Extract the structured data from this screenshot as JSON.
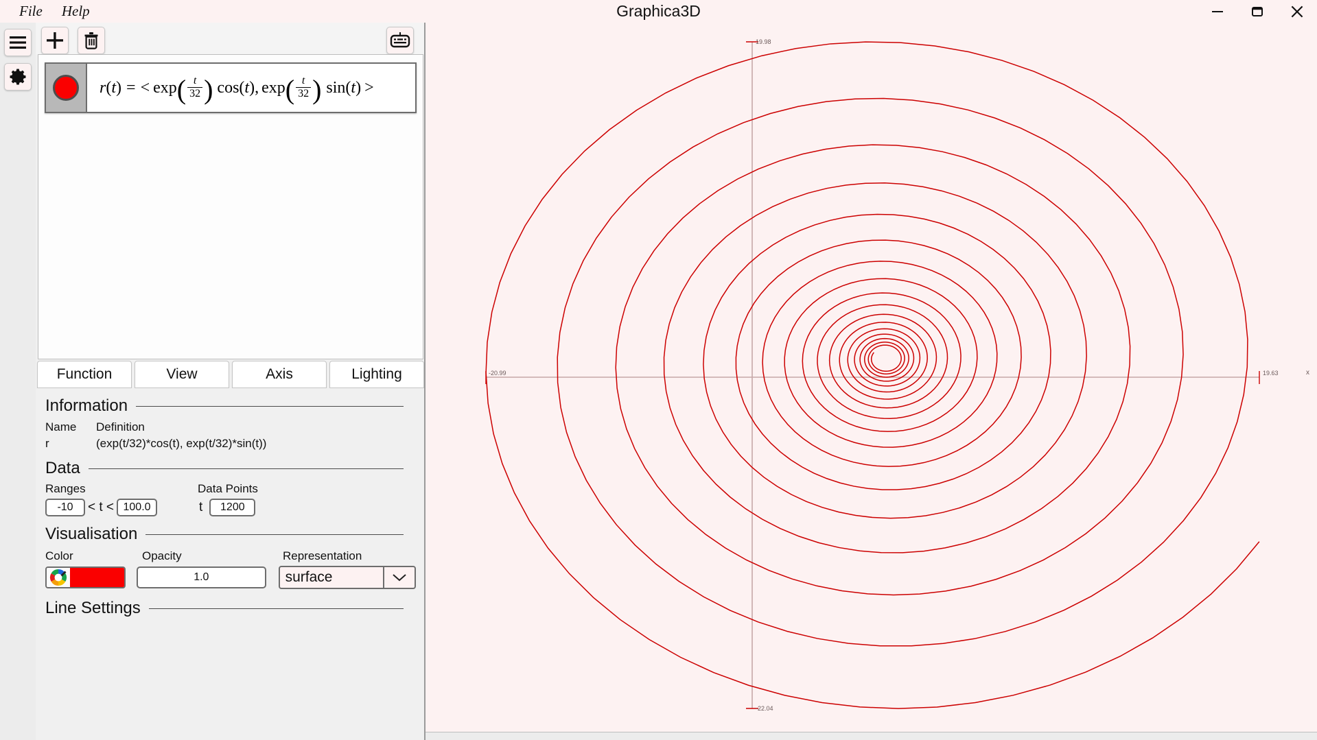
{
  "window": {
    "title": "Graphica3D",
    "menu": [
      {
        "label": "File",
        "name": "menu-file"
      },
      {
        "label": "Help",
        "name": "menu-help"
      }
    ],
    "controls": {
      "minimize": "minimize-icon",
      "restore": "restore-icon",
      "close": "close-icon"
    }
  },
  "rail": {
    "items": [
      {
        "label": "Menu",
        "icon": "hamburger-menu-icon"
      },
      {
        "label": "Settings",
        "icon": "gear-icon"
      }
    ]
  },
  "toolbar": {
    "add_label": "+",
    "add_icon": "plus-icon",
    "delete_icon": "trash-icon",
    "keyboard_icon": "keyboard-icon"
  },
  "functions": [
    {
      "name": "r",
      "color": "#fa0000",
      "equation_text": "r(t) = < exp(t/32) cos(t), exp(t/32) sin(t) >",
      "lhs": "r",
      "var": "t",
      "eq": "=",
      "open_angle": "<",
      "close_angle": ">",
      "exp": "exp",
      "cos": "cos",
      "sin": "sin",
      "num": "t",
      "den": "32",
      "comma": ","
    }
  ],
  "tabs": [
    {
      "label": "Function",
      "active": true
    },
    {
      "label": "View",
      "active": false
    },
    {
      "label": "Axis",
      "active": false
    },
    {
      "label": "Lighting",
      "active": false
    }
  ],
  "function_tab": {
    "information": {
      "heading": "Information",
      "col_name": "Name",
      "col_definition": "Definition",
      "row_name": "r",
      "row_definition": "(exp(t/32)*cos(t), exp(t/32)*sin(t))"
    },
    "data": {
      "heading": "Data",
      "ranges_label": "Ranges",
      "data_points_label": "Data Points",
      "range_min": "-10",
      "range_max": "100.0",
      "lt_left": "< t <",
      "var_label": "t",
      "data_points": "1200"
    },
    "visualisation": {
      "heading": "Visualisation",
      "color_label": "Color",
      "opacity_label": "Opacity",
      "representation_label": "Representation",
      "color_value": "#fa0000",
      "color_picker_icon": "color-wheel-icon",
      "opacity_value": "1.0",
      "representation_value": "surface",
      "dropdown_icon": "chevron-down-icon"
    },
    "line_settings": {
      "heading": "Line Settings"
    }
  },
  "chart_data": {
    "type": "line",
    "title": "",
    "xlabel": "x",
    "ylabel": "",
    "background": "#fdf2f2",
    "curve_color": "#cc0000",
    "axis_color": "#c6a8a8",
    "grid": false,
    "legend": null,
    "parametric": {
      "x_expr": "exp(t/32)*cos(t)",
      "y_expr": "exp(t/32)*sin(t)",
      "t_min": -10,
      "t_max": 100,
      "samples": 1200
    },
    "axes": {
      "x_tick_left": "-20.99",
      "x_tick_right": "19.63",
      "y_tick_top": "19.98",
      "y_tick_bottom": "-22.04",
      "x_axis_label": "x"
    },
    "xlim": [
      -20.99,
      19.63
    ],
    "ylim": [
      -22.04,
      19.98
    ]
  }
}
